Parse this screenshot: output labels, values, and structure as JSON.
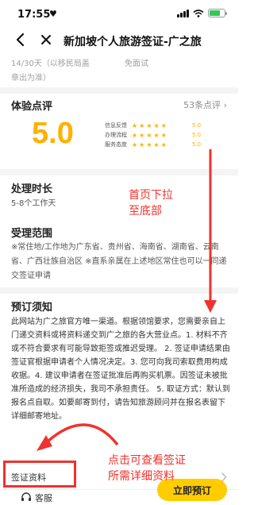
{
  "status_bar": {
    "time": "17:55",
    "battery_level": 0.7,
    "battery_color": "#34c759"
  },
  "nav": {
    "title": "新加坡个人旅游签证-广之旅"
  },
  "validity": {
    "stay_text": "14/30天（以移民局盖章出为准）",
    "interview_text": "免面试"
  },
  "reviews": {
    "title": "体验点评",
    "count_text": "53条点评",
    "score": "5.0",
    "score_color": "#ffb000",
    "items": [
      {
        "label": "信息反馈",
        "stars": 5,
        "value": "5.0"
      },
      {
        "label": "办理流程",
        "stars": 5,
        "value": "5.0"
      },
      {
        "label": "服务态度",
        "stars": 5,
        "value": "5.0"
      }
    ]
  },
  "processing": {
    "title": "处理时长",
    "text": "5-8个工作天"
  },
  "scope": {
    "title": "受理范围",
    "text": "※常住地/工作地为广东省、贵州省、海南省、湖南省、云南省、广西壮族自治区 ※直系亲属在上述地区常住也可以一同递交签证申请"
  },
  "notice": {
    "title": "预订须知",
    "text": "此网站为广之旅官方唯一渠道。根据领馆要求，您需要亲自上门递交资料或将资料递交到广之旅的各大营业点。1. 材料不齐或不符合要求有可能导致拒签或推迟受理。 2. 签证申请结果由签证官根据申请者个人情况决定。3. 您可向我司索取费用构成收据。4. 建议申请者在签证批准后再购买机票。因签证未被批准所造成的经济损失，我司不承担责任。 5. 取证方式：默认到报名点自取。如要邮寄到付，请告知旅游顾问并在报名表留下详细邮寄地址。"
  },
  "materials": {
    "label": "签证资料"
  },
  "bottom_bar": {
    "service_label": "客服",
    "book_label": "立即预订",
    "book_color": "#ffcc00"
  },
  "annotations": {
    "scroll_hint_line1": "首页下拉",
    "scroll_hint_line2": "至底部",
    "materials_hint_line1": "点击可查看签证",
    "materials_hint_line2": "所需详细资料",
    "color": "#f0322d"
  }
}
